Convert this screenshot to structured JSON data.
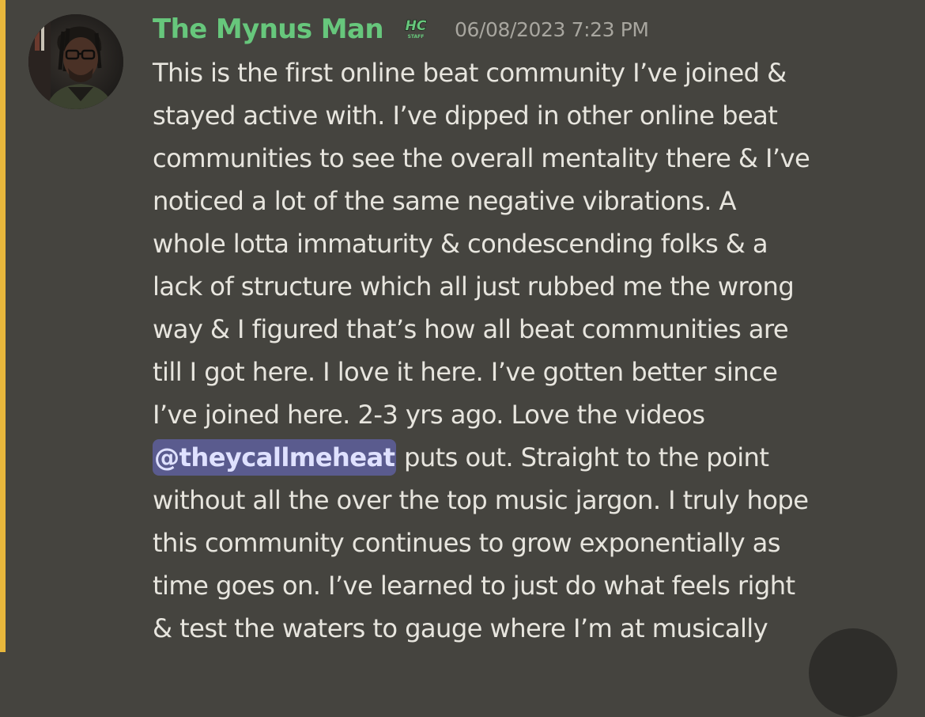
{
  "message": {
    "author": "The Mynus Man",
    "badge": {
      "text_top": "HC",
      "text_bottom": "STAFF",
      "icon": "hc-staff-badge-icon"
    },
    "timestamp": "06/08/2023 7:23 PM",
    "lines": [
      {
        "text": "This is the first online beat community I’ve joined &"
      },
      {
        "text": "stayed active with. I’ve dipped in other online beat"
      },
      {
        "text": "communities to see the overall mentality there & I’ve"
      },
      {
        "text": "noticed a lot of the same negative vibrations. A"
      },
      {
        "text": "whole lotta immaturity & condescending folks & a"
      },
      {
        "text": "lack of structure which all just rubbed me the wrong"
      },
      {
        "text": "way & I figured that’s how all beat communities are"
      },
      {
        "text": "till I got here. I love it here. I’ve gotten better since"
      },
      {
        "text": "I’ve joined here. 2-3 yrs ago. Love the videos"
      },
      {
        "mention": "@theycallmeheat",
        "after": " puts out. Straight to the point"
      },
      {
        "text": "without all the over the top music jargon. I truly hope"
      },
      {
        "text": "this community continues to grow exponentially as"
      },
      {
        "text": "time goes on. I’ve learned to just do what feels right"
      },
      {
        "text": "& test the waters to gauge where I’m at musically"
      }
    ]
  },
  "colors": {
    "background": "#45443f",
    "mention_bar": "#e7b73c",
    "username": "#67c77c",
    "text": "#e7e5de",
    "timestamp": "#a8a69f",
    "mention_bg": "#5a5b8e",
    "badge_green": "#67c77c"
  }
}
